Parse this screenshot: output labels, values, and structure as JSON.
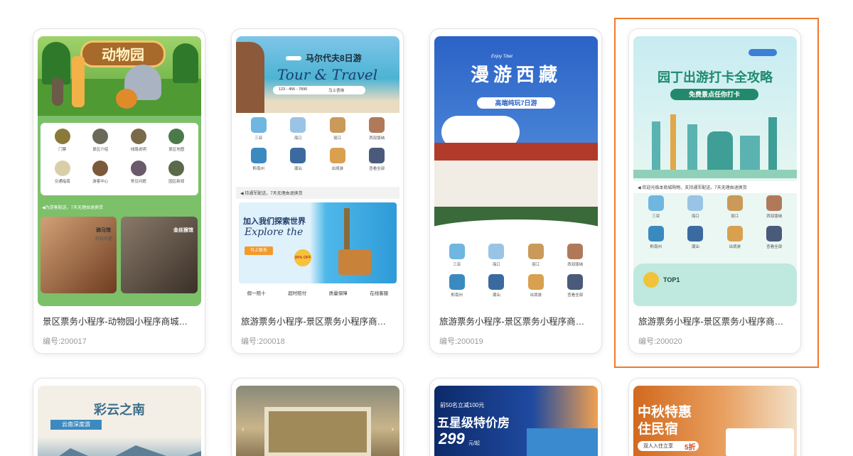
{
  "cards": [
    {
      "title": "景区票务小程序-动物园小程序商城模板",
      "code": "编号:200017",
      "banner_text": "动物园",
      "icons": [
        "门票",
        "景区介绍",
        "线路说明",
        "景区地图",
        "交通指南",
        "游客中心",
        "常见问题",
        "园区新闻"
      ],
      "notice": "◀为游客配送，7天无理由退换货",
      "animals": [
        {
          "name": "骑马馆",
          "desc": "好玩有趣"
        },
        {
          "name": "金丝猴馆",
          "desc": ""
        }
      ]
    },
    {
      "title": "旅游票务小程序-景区票务小程序商城模板",
      "code": "编号:200018",
      "banner_title": "马尔代夫8日游",
      "banner_script": "Tour & Travel",
      "banner_phone": "123 - 456 - 7890",
      "banner_cta": "马上咨询",
      "icons": [
        "三亚",
        "海口",
        "丽江",
        "西双版纳",
        "黔南州",
        "潮汕",
        "出境游",
        "查看全部"
      ],
      "notice": "◀ 持通军配送，7天无理由退换货",
      "ad_title": "加入我们探索世界",
      "ad_script": "Explore the",
      "ad_button": "马上联系",
      "ad_badge": "30% OFF",
      "guarantees": [
        "假一赔十",
        "超时赔付",
        "质量保障",
        "在线客服"
      ]
    },
    {
      "title": "旅游票务小程序-景区票务小程序商城模板",
      "code": "编号:200019",
      "banner_tag": "Enjoy Tibet",
      "banner_title": "漫游西藏",
      "banner_sub": "高端纯玩7日游",
      "icons": [
        "三亚",
        "海口",
        "丽江",
        "西双版纳",
        "黔南州",
        "潮汕",
        "出境游",
        "查看全部"
      ]
    },
    {
      "title": "旅游票务小程序-景区票务小程序商城模板",
      "code": "编号:200020",
      "banner_title": "园丁出游打卡全攻略",
      "banner_sub": "免费景点任你打卡",
      "notice": "◀ 欢迎光临本商城购物，支持通军配送，7天无理由退换货",
      "icons": [
        "三亚",
        "海口",
        "丽江",
        "西双版纳",
        "黔南州",
        "潮汕",
        "出境游",
        "查看全部"
      ],
      "top_label": "TOP1"
    }
  ],
  "row2": [
    {
      "banner_title": "彩云之南",
      "banner_sub": "云南深度游"
    },
    {
      "banner_title": ""
    },
    {
      "banner_promo": "前50名立减100元",
      "banner_title": "五星级特价房",
      "banner_price": "299",
      "banner_unit": "元/起"
    },
    {
      "banner_title": "中秋特惠",
      "banner_title2": "住民宿",
      "banner_sub": "双人入住立享",
      "banner_discount": "5折"
    }
  ],
  "colors": {
    "accent": "#f07a2a",
    "zoo_green": "#7cc06a",
    "tibet_blue": "#2b62c6",
    "mint": "#bfe8df"
  }
}
